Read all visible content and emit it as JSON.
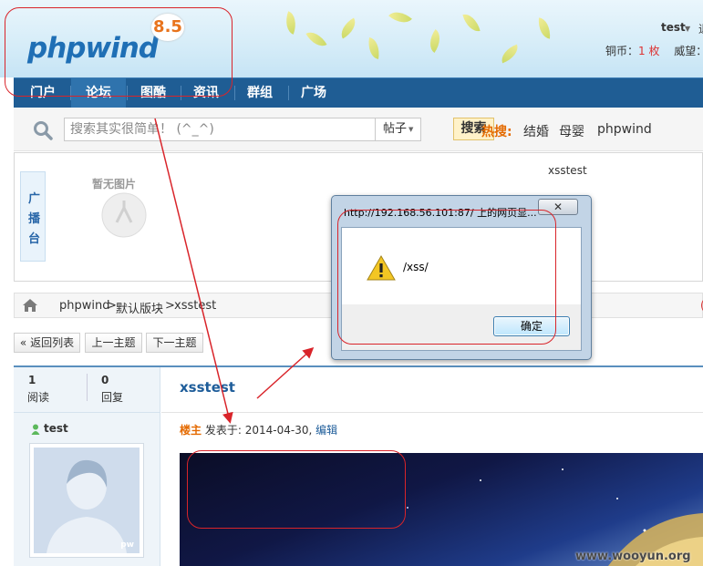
{
  "header": {
    "logo_text": "phpwind",
    "logo_version": "8.5",
    "user_name": "test",
    "user_extra": "退",
    "coins_label": "铜币：",
    "coins_value": "1 枚",
    "prestige_label": "威望："
  },
  "nav": {
    "items": [
      {
        "label": "门户"
      },
      {
        "label": "论坛",
        "active": true
      },
      {
        "label": "图酷"
      },
      {
        "label": "资讯"
      },
      {
        "label": "群组"
      },
      {
        "label": "广场"
      }
    ]
  },
  "search": {
    "placeholder": "搜索其实很简单！ (^_^)",
    "type": "帖子",
    "button": "搜索",
    "hot_label": "热搜:",
    "hot_items": [
      "结婚",
      "母婴",
      "phpwind"
    ]
  },
  "broadcast": {
    "tab_chars": [
      "广",
      "播",
      "台"
    ],
    "no_image": "暂无图片",
    "title": "xsstest"
  },
  "breadcrumb": {
    "items": [
      "phpwind",
      ">",
      "默认版块",
      ">",
      "xsstest"
    ],
    "right": "("
  },
  "actions": {
    "back": "« 返回列表",
    "prev": "上一主题",
    "next": "下一主题"
  },
  "post": {
    "stats": [
      {
        "value": "1",
        "label": "阅读"
      },
      {
        "value": "0",
        "label": "回复"
      }
    ],
    "title": "xsstest",
    "author": "test",
    "avatar_tag": "pw",
    "role": "楼主",
    "posted_label": "发表于:",
    "date": "2014-04-30",
    "sep": ",",
    "edit": "编辑"
  },
  "dialog": {
    "title": "http://192.168.56.101:87/ 上的网页显...",
    "close": "关闭",
    "message": "/xss/",
    "ok": "确定"
  },
  "watermark": "www.wooyun.org",
  "colors": {
    "nav_bg": "#1f5d94",
    "annotation": "#d9242a",
    "hot": "#e46a00",
    "link": "#1e5d9a"
  }
}
